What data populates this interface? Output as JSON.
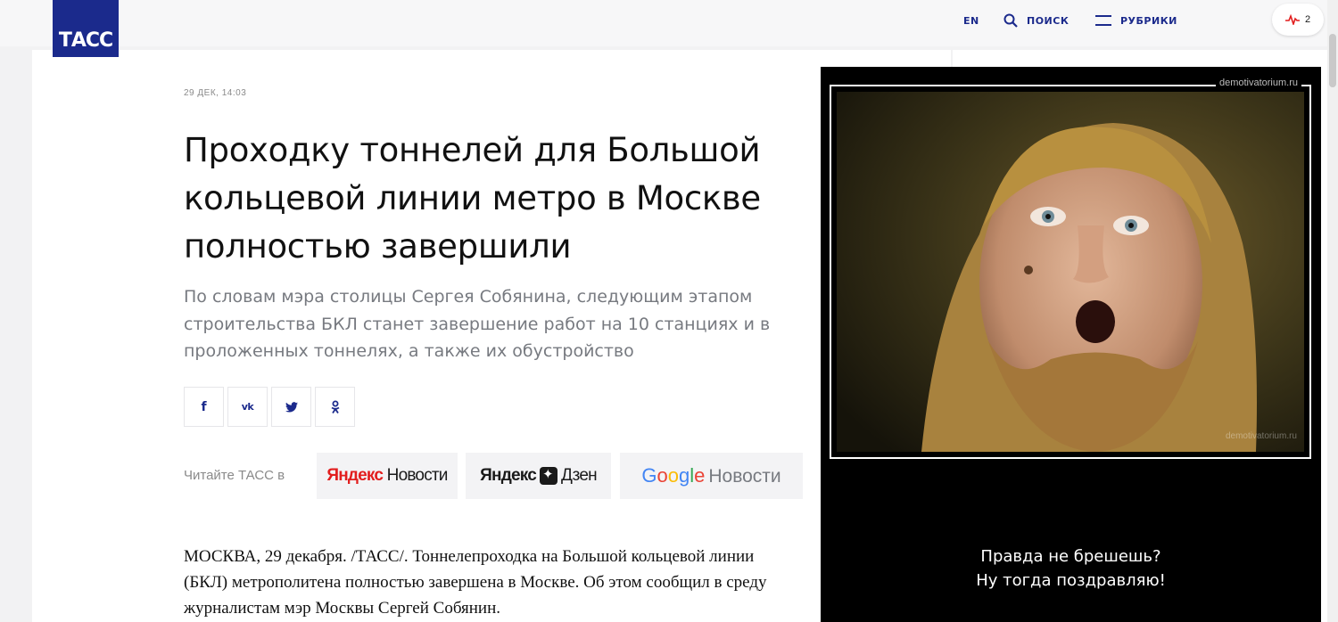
{
  "header": {
    "logo_text": "ТАСС",
    "lang_link": "EN",
    "search_label": "ПОИСК",
    "rubrics_label": "РУБРИКИ",
    "pulse_count": "2",
    "brand_color": "#1b2a8c"
  },
  "article": {
    "date": "29 ДЕК, 14:03",
    "headline": "Проходку тоннелей для Большой кольцевой линии метро в Москве полностью завершили",
    "lead": "По словам мэра столицы Сергея Собянина, следующим этапом строительства БКЛ станет завершение работ на 10 станциях и в проложенных тоннелях, а также их обустройство",
    "share_buttons": [
      {
        "label": "f",
        "icon": "facebook-icon"
      },
      {
        "label": "vk",
        "icon": "vk-icon"
      },
      {
        "label": "twitter",
        "icon": "twitter-icon"
      },
      {
        "label": "ok",
        "icon": "odnoklassniki-icon"
      }
    ],
    "read_in_label": "Читайте ТАСС в",
    "aggregators": {
      "yandex_news": {
        "brand": "Яндекс",
        "service": "Новости"
      },
      "yandex_zen": {
        "brand": "Яндекс",
        "service": "Дзен"
      },
      "google_news": {
        "letters": [
          "G",
          "o",
          "o",
          "g",
          "l",
          "e"
        ],
        "service": "Новости"
      }
    },
    "body": "МОСКВА, 29 декабря. /ТАСС/. Тоннелепроходка на Большой кольцевой линии (БКЛ) метрополитена полностью завершена в Москве. Об этом сообщил в среду журналистам мэр Москвы Сергей Собянин."
  },
  "meme": {
    "site_label": "demotivatorium.ru",
    "watermark": "demotivatorium.ru",
    "caption_line1": "Правда не брешешь?",
    "caption_line2": "Ну тогда поздравляю!"
  }
}
